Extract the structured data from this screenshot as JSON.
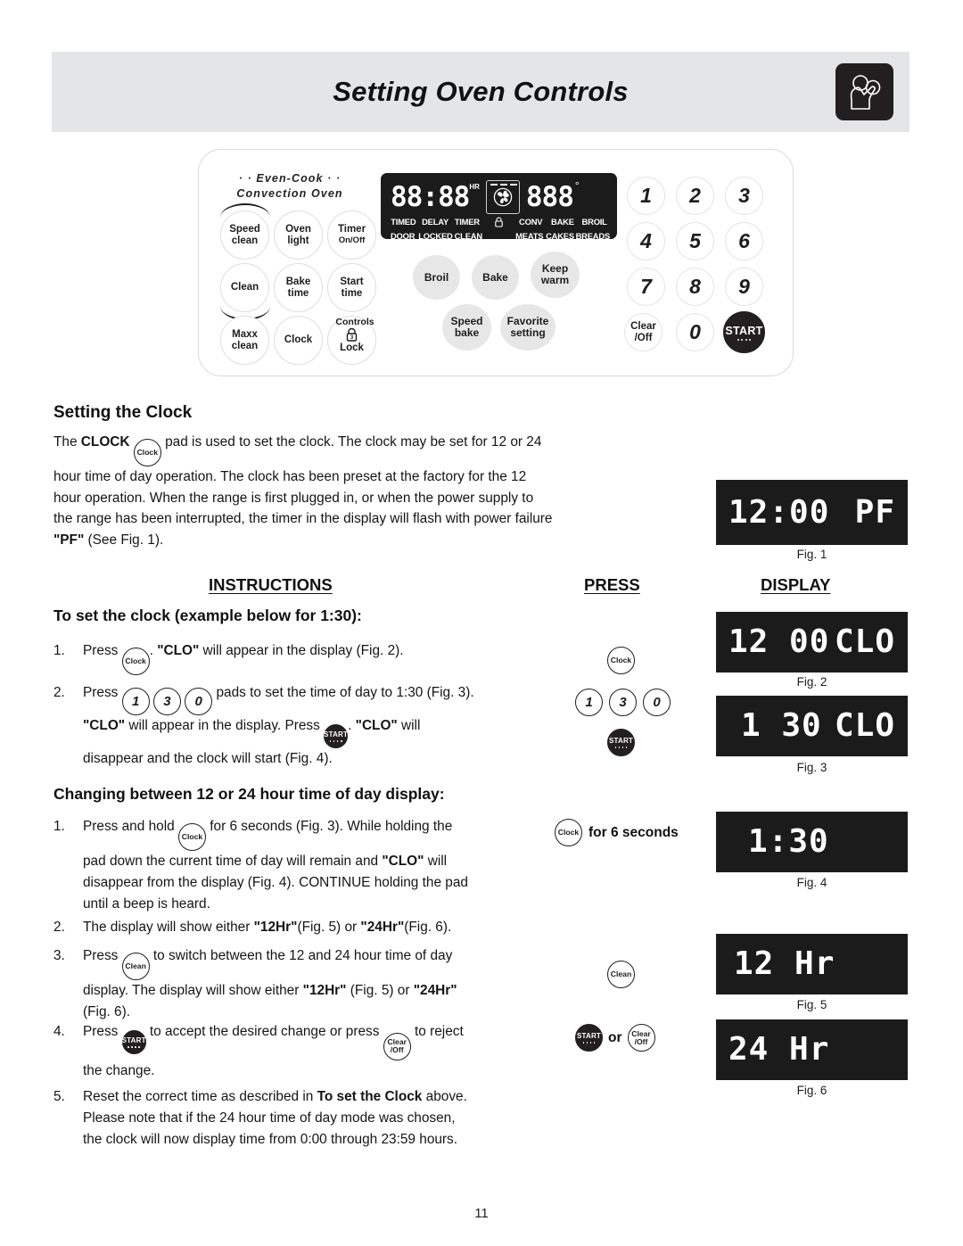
{
  "header": {
    "title": "Setting Oven Controls",
    "icon": "hand-pressing-controls-icon"
  },
  "control_panel": {
    "brand_line1": "· · Even-Cook · ·",
    "brand_line2": "Convection Oven",
    "left_pads": [
      {
        "label": "Speed",
        "sub": "clean"
      },
      {
        "label": "Oven",
        "sub": "light"
      },
      {
        "label": "Timer",
        "sub": "On/Off"
      },
      {
        "label": "Clean",
        "sub": ""
      },
      {
        "label": "Bake",
        "sub": "time"
      },
      {
        "label": "Start",
        "sub": "time"
      },
      {
        "label": "Maxx",
        "sub": "clean"
      },
      {
        "label": "Clock",
        "sub": ""
      },
      {
        "label": "Lock",
        "sub": ""
      }
    ],
    "controls_label": "Controls",
    "lock_badge": "3",
    "display": {
      "time_digits": "88:88",
      "hr_tag": "HR",
      "temp_digits": "888",
      "degree": "°",
      "indicators_top": [
        "TIMED",
        "DELAY",
        "TIMER",
        "",
        "CONV",
        "BAKE",
        "BROIL"
      ],
      "indicators_bottom": [
        "DOOR",
        "LOCKED",
        "CLEAN",
        "",
        "MEATS",
        "CAKES",
        "BREADS"
      ],
      "lock_icon": "padlock-icon",
      "fan_icon": "convection-fan-icon"
    },
    "function_pads": [
      {
        "label": "Broil",
        "sub": ""
      },
      {
        "label": "Bake",
        "sub": ""
      },
      {
        "label": "Keep",
        "sub": "warm"
      },
      {
        "label": "Speed",
        "sub": "bake"
      },
      {
        "label": "Favorite",
        "sub": "setting"
      }
    ],
    "keypad": [
      "1",
      "2",
      "3",
      "4",
      "5",
      "6",
      "7",
      "8",
      "9",
      "0"
    ],
    "clear_off": {
      "line1": "Clear",
      "line2": "/Off"
    },
    "start": "START"
  },
  "setting_clock": {
    "heading": "Setting the Clock",
    "para_a": "The ",
    "para_clock_bold": "CLOCK",
    "pad_label": "Clock",
    "para_b": " pad is used to set the clock. The clock may be",
    "para_rest": "set for 12 or 24 hour time of day operation.  The clock has been preset at the factory for the 12 hour operation.  When the range is first plugged in, or when the power supply to the range has been interrupted, the timer in the display will flash with power failure ",
    "pf_bold": "\"PF\"",
    "para_end": " (See Fig. 1)."
  },
  "columns": {
    "instructions": "INSTRUCTIONS",
    "press": "PRESS",
    "display": "DISPLAY"
  },
  "set_clock_section": {
    "heading": "To set the clock (example below for 1:30):",
    "step1": {
      "num": "1.",
      "t1": "Press ",
      "pad": "Clock",
      "t2": ".  ",
      "clo": "\"CLO\"",
      "t3": " will appear in the display (Fig. 2)."
    },
    "step2": {
      "num": "2.",
      "t1": "Press ",
      "keys": [
        "1",
        "3",
        "0"
      ],
      "t2": " pads to set the time of day to 1:30 (Fig. 3).",
      "l2a": "\"CLO\"",
      "l2b": " will appear in the display.  Press ",
      "start": "START",
      "l2c": ". ",
      "l2d": "\"CLO\"",
      "l2e": " will",
      "l3": "disappear and the clock will start (Fig. 4)."
    }
  },
  "hour_section": {
    "heading": "Changing between 12 or 24 hour time of day display:",
    "step1": {
      "num": "1.",
      "t1": "Press and hold ",
      "pad": "Clock",
      "t2": " for 6 seconds (Fig. 3). While holding the",
      "l2a": "pad down the current time of day will remain and ",
      "clo": "\"CLO\"",
      "l2b": " will",
      "l3": "disappear from the display (Fig. 4). CONTINUE holding the pad",
      "l4": "until a beep is heard."
    },
    "step2": {
      "num": "2.",
      "t1": "The display will show either ",
      "b1": "\"12Hr\"",
      "t2": "(Fig. 5) or ",
      "b2": "\"24Hr\"",
      "t3": "(Fig. 6)."
    },
    "step3": {
      "num": "3.",
      "t1": "Press ",
      "pad": "Clean",
      "t2": " to switch between the 12 and 24 hour time of day",
      "l2a": "display. The display will show either ",
      "b1": "\"12Hr\"",
      "l2b": " (Fig. 5) or ",
      "b2": "\"24Hr\"",
      "l3": "(Fig. 6)."
    },
    "step4": {
      "num": "4.",
      "t1": "Press ",
      "start": "START",
      "t2": " to accept the desired change or press ",
      "clear1": "Clear",
      "clear2": "/Off",
      "t3": " to reject",
      "l2": "the change."
    },
    "step5": {
      "num": "5.",
      "t1": "Reset the correct time as described in ",
      "b1": "To set the Clock",
      "t2": " above.",
      "l2": "Please note that if the 24 hour time of day mode was chosen,",
      "l3": "the clock will now display time from 0:00 through 23:59 hours."
    }
  },
  "press_column": {
    "item1_pad": "Clock",
    "item2_keys": [
      "1",
      "3",
      "0"
    ],
    "item2_start": "START",
    "item3_pad": "Clock",
    "item3_text": "for 6 seconds",
    "item4_pad": "Clean",
    "item5_start": "START",
    "item5_or": "or",
    "item5_clear1": "Clear",
    "item5_clear2": "/Off"
  },
  "figures": [
    {
      "id": "fig1",
      "lcd_left": "12:00",
      "lcd_right": "PF",
      "caption": "Fig. 1"
    },
    {
      "id": "fig2",
      "lcd_left": "12 00",
      "lcd_right": "CLO",
      "caption": "Fig. 2"
    },
    {
      "id": "fig3",
      "lcd_left": "1 30",
      "lcd_right": "CLO",
      "caption": "Fig. 3"
    },
    {
      "id": "fig4",
      "lcd_left": "1:30",
      "lcd_right": "",
      "caption": "Fig. 4"
    },
    {
      "id": "fig5",
      "lcd_left": "12 Hr",
      "lcd_right": "",
      "caption": "Fig. 5"
    },
    {
      "id": "fig6",
      "lcd_left": "24 Hr",
      "lcd_right": "",
      "caption": "Fig. 6"
    }
  ],
  "page_number": "11"
}
